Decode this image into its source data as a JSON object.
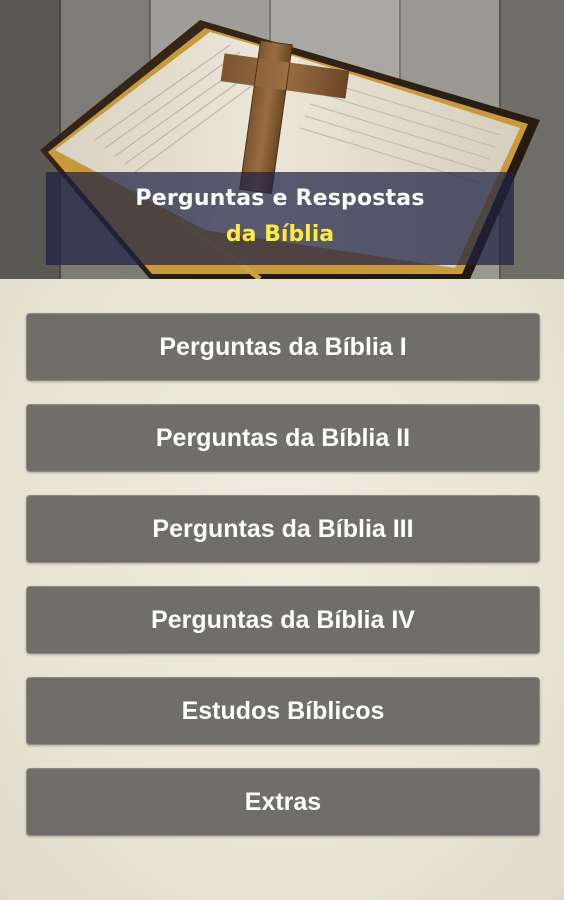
{
  "header": {
    "title_line1": "Perguntas e Respostas",
    "title_line2": "da Bíblia",
    "image": "bible-with-wooden-cross"
  },
  "menu": {
    "items": [
      {
        "label": "Perguntas da Bíblia I"
      },
      {
        "label": "Perguntas da Bíblia II"
      },
      {
        "label": "Perguntas da Bíblia III"
      },
      {
        "label": "Perguntas da Bíblia IV"
      },
      {
        "label": "Estudos Bíblicos"
      },
      {
        "label": "Extras"
      }
    ]
  },
  "colors": {
    "button_bg": "#6f6e68",
    "button_text": "#ffffff",
    "title_white": "#ffffff",
    "title_yellow": "#ffeb3b",
    "banner_bg": "#1e2144",
    "page_bg": "#e9e6d8"
  }
}
